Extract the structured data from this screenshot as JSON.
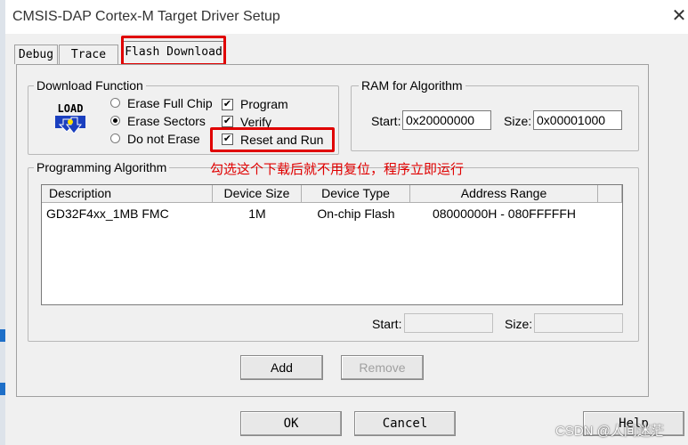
{
  "window": {
    "title": "CMSIS-DAP Cortex-M Target Driver Setup",
    "close_glyph": "✕"
  },
  "tabs": [
    {
      "label": "Debug"
    },
    {
      "label": "Trace"
    },
    {
      "label": "Flash Download",
      "active": true
    }
  ],
  "download_function": {
    "legend": "Download Function",
    "load_icon_text": "LOAD",
    "radios": [
      {
        "label": "Erase Full Chip",
        "selected": false
      },
      {
        "label": "Erase Sectors",
        "selected": true
      },
      {
        "label": "Do not Erase",
        "selected": false
      }
    ],
    "checks": [
      {
        "label": "Program",
        "checked": true
      },
      {
        "label": "Verify",
        "checked": true
      },
      {
        "label": "Reset and Run",
        "checked": true
      }
    ]
  },
  "ram_for_algorithm": {
    "legend": "RAM for Algorithm",
    "start_label": "Start:",
    "start_value": "0x20000000",
    "size_label": "Size:",
    "size_value": "0x00001000"
  },
  "programming_algorithm": {
    "legend": "Programming Algorithm",
    "columns": [
      "Description",
      "Device Size",
      "Device Type",
      "Address Range"
    ],
    "rows": [
      {
        "description": "GD32F4xx_1MB FMC",
        "device_size": "1M",
        "device_type": "On-chip Flash",
        "address_range": "08000000H - 080FFFFFH"
      }
    ],
    "start_label": "Start:",
    "start_value": "",
    "size_label": "Size:",
    "size_value": ""
  },
  "annotation": "勾选这个下载后就不用复位，程序立即运行",
  "buttons": {
    "add": "Add",
    "remove": "Remove",
    "ok": "OK",
    "cancel": "Cancel",
    "help": "Help"
  },
  "watermark": "CSDN @人间迷茫",
  "colors": {
    "highlight_red": "#e00000",
    "load_icon_blue": "#1a3fbf"
  }
}
